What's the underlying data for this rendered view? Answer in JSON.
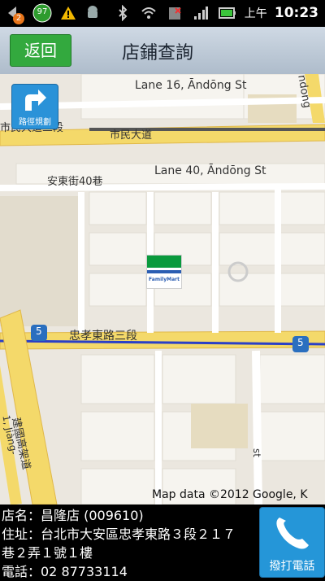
{
  "statusbar": {
    "notification_badge": "2",
    "battery_level_badge": "97",
    "ampm": "上午",
    "time": "10:23",
    "icons": [
      "usb-icon",
      "notification-icon",
      "warning-icon",
      "android-icon",
      "bluetooth-icon",
      "wifi-icon",
      "sim-missing-icon",
      "signal-icon",
      "battery-icon"
    ]
  },
  "header": {
    "back_label": "返回",
    "title": "店鋪查詢"
  },
  "map": {
    "route_button_label": "路徑規劃",
    "labels": {
      "lane16": "Lane 16, Āndōng St",
      "shimin_road_prefix": "市民大道三段",
      "shimin_road": "市民大道",
      "andong_40_zh": "安東街40巷",
      "lane40": "Lane 40, Āndōng St",
      "zhongxiao_road": "忠孝東路三段",
      "route_5_a": "5",
      "route_5_b": "5",
      "jianguo_road": "建國高架道",
      "jianguo_en": "1, Jiàng-",
      "andong_right": "ndong",
      "vertical_right": "st"
    },
    "marker_text": "FamilyMart",
    "attribution": "Map data ©2012 Google, K"
  },
  "store": {
    "name_line": "店名：昌隆店 (009610)",
    "address_line1": "住址：台北市大安區忠孝東路３段２１７",
    "address_line2": "巷２弄１號１樓",
    "phone_line": "電話：02 87733114",
    "call_label": "撥打電話"
  },
  "colors": {
    "back_button": "#33a93e",
    "blue_button": "#2596d8",
    "road_yellow": "#f4d96a",
    "route_blue": "#2a3fc7"
  }
}
